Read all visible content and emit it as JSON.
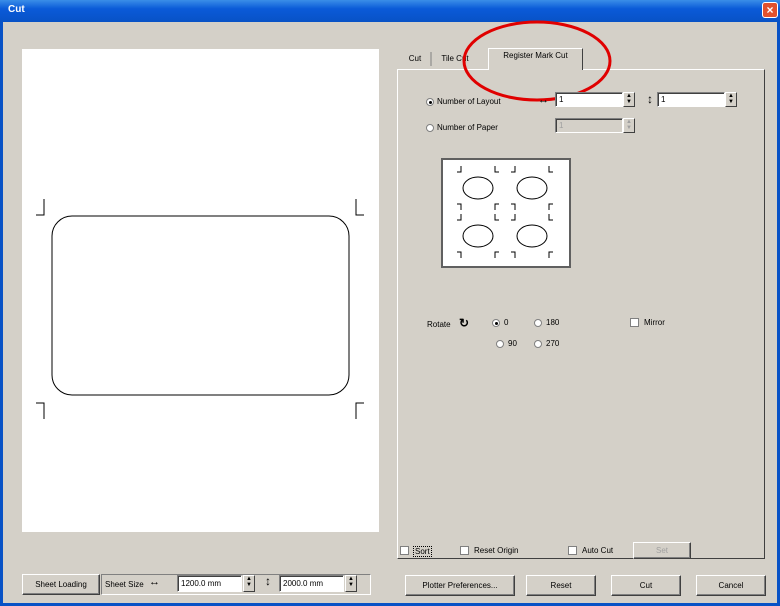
{
  "window": {
    "title": "Cut"
  },
  "tabs": [
    {
      "label": "Cut"
    },
    {
      "label": "Tile Cut"
    },
    {
      "label": "Register Mark Cut"
    }
  ],
  "layout": {
    "number_of_layout_label": "Number of Layout",
    "layout_h_value": "1",
    "layout_v_value": "1",
    "number_of_paper_label": "Number of Paper",
    "paper_value": "1"
  },
  "rotate": {
    "label": "Rotate",
    "options": [
      "0",
      "180",
      "90",
      "270"
    ],
    "selected": "0",
    "mirror_label": "Mirror"
  },
  "options_row": {
    "sort_label": "Sort",
    "reset_origin_label": "Reset Origin",
    "auto_cut_label": "Auto Cut",
    "set_label": "Set"
  },
  "sheet": {
    "loading_label": "Sheet Loading",
    "size_label": "Sheet Size",
    "width_value": "1200.0 mm",
    "height_value": "2000.0 mm"
  },
  "actions": {
    "plotter_preferences": "Plotter Preferences...",
    "reset": "Reset",
    "cut": "Cut",
    "cancel": "Cancel"
  },
  "colors": {
    "titlebar": "#0852c6",
    "highlight_circle": "#e00000"
  }
}
